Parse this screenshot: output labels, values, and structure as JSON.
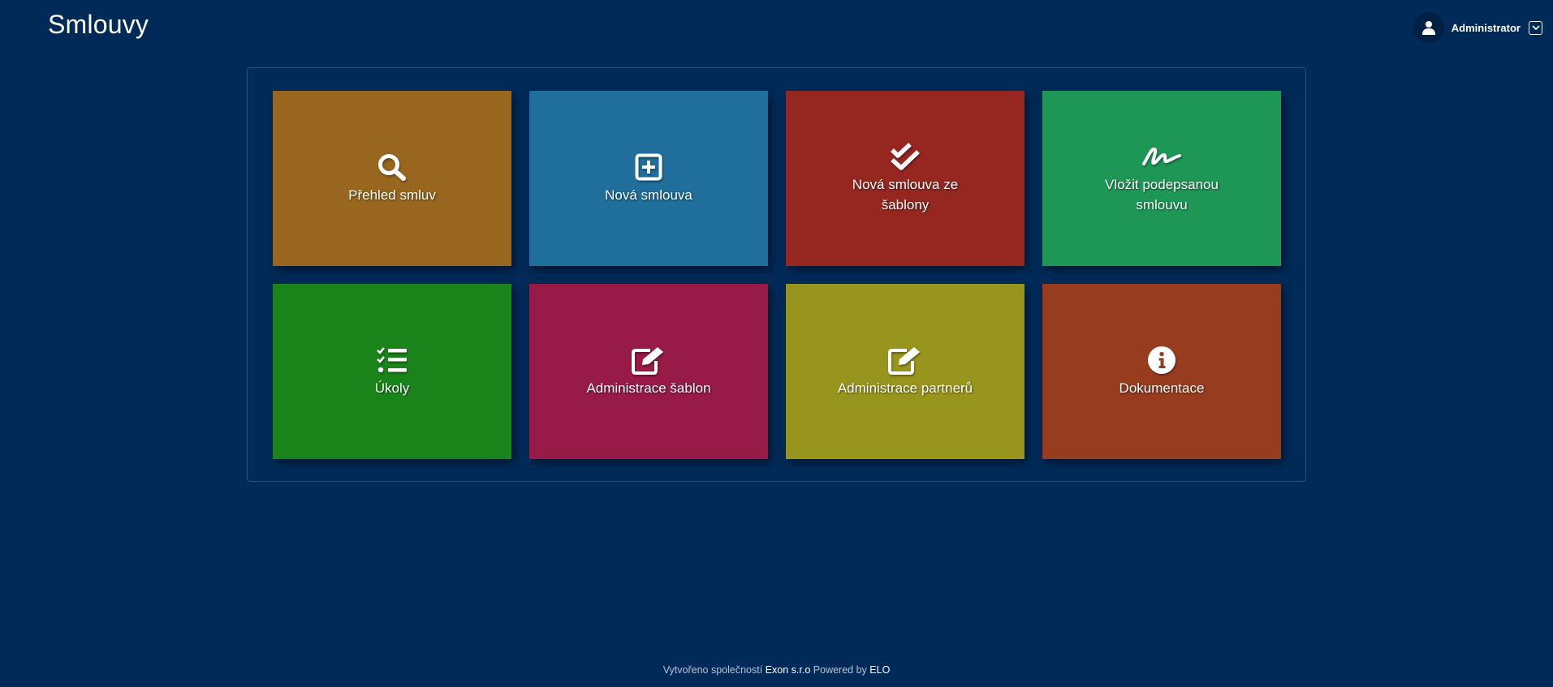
{
  "header": {
    "title": "Smlouvy",
    "user": {
      "name": "Administrator",
      "avatar_icon": "user-icon",
      "toggle_icon": "chevron-down-icon"
    }
  },
  "tiles": [
    {
      "label": "Přehled smluv",
      "icon": "search-icon",
      "color": "#98661e"
    },
    {
      "label": "Nová smlouva",
      "icon": "plus-square-icon",
      "color": "#1f6e9b"
    },
    {
      "label": "Nová smlouva ze šablony",
      "icon": "double-check-icon",
      "color": "#962620"
    },
    {
      "label": "Vložit podepsanou smlouvu",
      "icon": "signature-icon",
      "color": "#1e9756"
    },
    {
      "label": "Úkoly",
      "icon": "tasks-list-icon",
      "color": "#1a841b"
    },
    {
      "label": "Administrace šablon",
      "icon": "edit-icon",
      "color": "#971b46"
    },
    {
      "label": "Administrace partnerů",
      "icon": "edit-icon",
      "color": "#98951e"
    },
    {
      "label": "Dokumentace",
      "icon": "info-circle-icon",
      "color": "#983c1f"
    }
  ],
  "footer": {
    "created_by_label": "Vytvořeno společností",
    "company": "Exon s.r.o",
    "powered_by_label": "Powered by",
    "product": "ELO"
  }
}
